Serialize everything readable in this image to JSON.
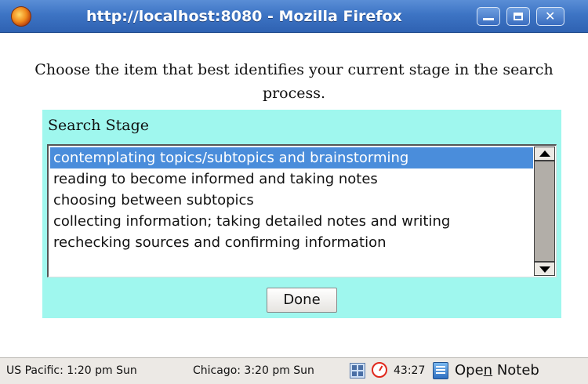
{
  "window": {
    "title": "http://localhost:8080 - Mozilla Firefox",
    "icon": "firefox-icon",
    "controls": [
      "minimize-icon",
      "maximize-icon",
      "close-icon"
    ]
  },
  "prompt": "Choose the item that best identifies your current stage in the search process.",
  "panel": {
    "label": "Search Stage",
    "background_color": "#9ff7ee",
    "options": [
      {
        "label": "contemplating topics/subtopics and brainstorming",
        "selected": true
      },
      {
        "label": "reading to become informed and taking notes",
        "selected": false
      },
      {
        "label": "choosing between subtopics",
        "selected": false
      },
      {
        "label": "collecting information; taking detailed notes and writing",
        "selected": false
      },
      {
        "label": "rechecking sources and confirming information",
        "selected": false
      }
    ],
    "selection_color": "#4a8ddb",
    "done_label": "Done"
  },
  "statusbar": {
    "clock_pacific": "US Pacific: 1:20 pm Sun",
    "clock_chicago": "Chicago: 3:20 pm Sun",
    "timer": "43:27",
    "notebook_before": "Ope",
    "notebook_accel": "n",
    "notebook_after": " Noteb",
    "icons": [
      "applet-grid-icon",
      "timer-icon",
      "notebook-icon"
    ]
  }
}
